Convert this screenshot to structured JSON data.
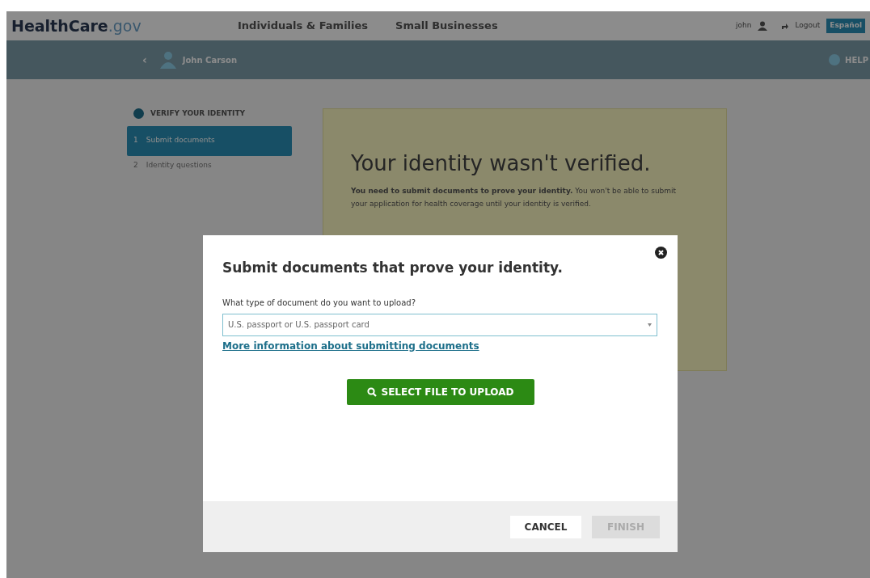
{
  "header": {
    "logo_main": "HealthCare",
    "logo_suffix": ".gov",
    "nav": [
      "Individuals & Families",
      "Small Businesses"
    ],
    "user": "john",
    "logout": "Logout",
    "language": "Español"
  },
  "subheader": {
    "back": "‹",
    "name": "John Carson",
    "help": "HELP"
  },
  "sidebar": {
    "title": "VERIFY YOUR IDENTITY",
    "items": [
      {
        "number": "1",
        "label": "Submit documents",
        "selected": true
      },
      {
        "number": "2",
        "label": "Identity questions",
        "selected": false
      }
    ]
  },
  "card": {
    "heading": "Your identity wasn't verified.",
    "body": "**You need to submit documents to prove your identity.** You won't be able to submit your application for health coverage until your identity is verified."
  },
  "dialog": {
    "title": "Submit documents that prove your identity.",
    "field_label": "What type of document do you want to upload?",
    "select_value": "U.S. passport or U.S. passport card",
    "link": "More information about submitting documents",
    "upload_button": "SELECT FILE TO UPLOAD",
    "buttons": [
      {
        "label": "CANCEL",
        "disabled": false
      },
      {
        "label": "FINISH",
        "disabled": true
      }
    ]
  }
}
